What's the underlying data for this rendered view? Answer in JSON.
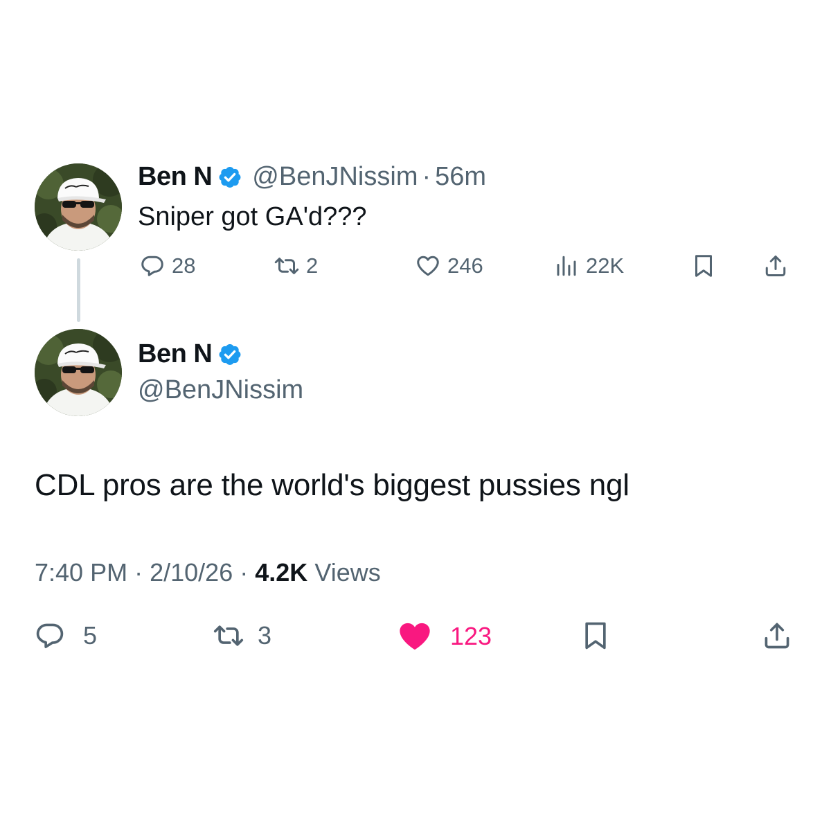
{
  "parent_tweet": {
    "display_name": "Ben N",
    "handle": "@BenJNissim",
    "separator": "·",
    "time": "56m",
    "text": "Sniper got GA'd???",
    "actions": {
      "replies": "28",
      "reposts": "2",
      "likes": "246",
      "views": "22K"
    }
  },
  "main_tweet": {
    "display_name": "Ben N",
    "handle": "@BenJNissim",
    "text": "CDL pros are the world's biggest pussies ngl",
    "meta": {
      "time": "7:40 PM",
      "separator": "·",
      "date": "2/10/26",
      "views_count": "4.2K",
      "views_label": "Views"
    },
    "actions": {
      "replies": "5",
      "reposts": "3",
      "likes": "123",
      "liked": true
    }
  },
  "colors": {
    "verified": "#1d9bf0",
    "like_active": "#f91880",
    "secondary_text": "#536471",
    "thread_line": "#cfd9de"
  },
  "icons": {
    "verified": "verified-badge-icon",
    "reply": "reply-icon",
    "repost": "repost-icon",
    "like": "heart-icon",
    "views": "analytics-icon",
    "bookmark": "bookmark-icon",
    "share": "share-icon"
  }
}
